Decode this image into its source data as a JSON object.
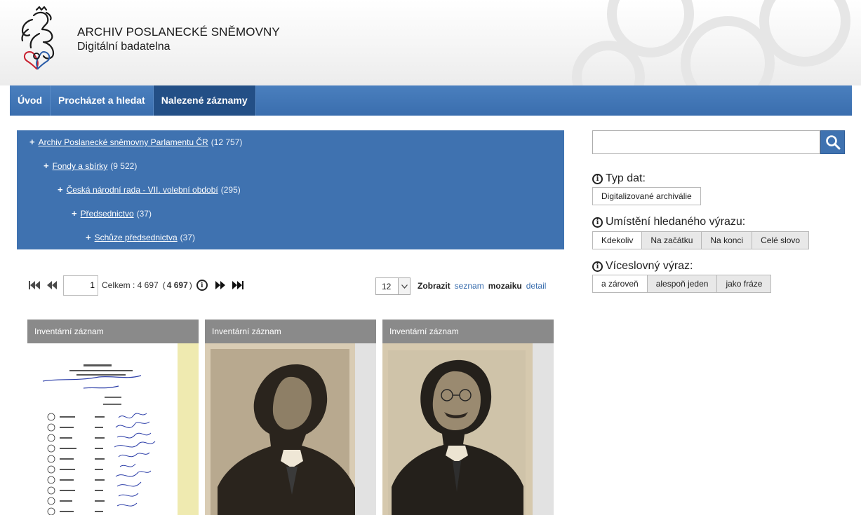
{
  "header": {
    "title": "ARCHIV POSLANECKÉ SNĚMOVNY",
    "subtitle": "Digitální badatelna"
  },
  "nav": {
    "items": [
      {
        "label": "Úvod"
      },
      {
        "label": "Procházet a hledat"
      },
      {
        "label": "Nalezené záznamy",
        "active": true
      }
    ]
  },
  "tree": {
    "items": [
      {
        "label": "Archiv Poslanecké sněmovny Parlamentu ČR",
        "count": "(12 757)"
      },
      {
        "label": "Fondy a sbírky",
        "count": "(9 522)"
      },
      {
        "label": "Česká národní rada - VII. volební období",
        "count": "(295)"
      },
      {
        "label": "Předsednictvo",
        "count": "(37)"
      },
      {
        "label": "Schůze předsednictva",
        "count": "(37)"
      }
    ]
  },
  "pager": {
    "page": "1",
    "total_label": "Celkem : 4 697",
    "total_bold": "4 697",
    "per_page": "12"
  },
  "view": {
    "label": "Zobrazit",
    "list": "seznam",
    "mosaic": "mozaiku",
    "detail": "detail"
  },
  "cards": [
    {
      "title": "Inventární záznam"
    },
    {
      "title": "Inventární záznam"
    },
    {
      "title": "Inventární záznam"
    }
  ],
  "search": {
    "placeholder": "",
    "value": ""
  },
  "facets": {
    "data_type": {
      "title": "Typ dat:",
      "options": [
        "Digitalizované archiválie"
      ]
    },
    "position": {
      "title": "Umístění hledaného výrazu:",
      "options": [
        "Kdekoliv",
        "Na začátku",
        "Na konci",
        "Celé slovo"
      ],
      "selected": "Kdekoliv"
    },
    "multiword": {
      "title": "Víceslovný výraz:",
      "options": [
        "a zároveň",
        "alespoň jeden",
        "jako fráze"
      ],
      "selected": "a zároveň"
    }
  },
  "colors": {
    "nav": "#3a6eae",
    "nav_active": "#234f86",
    "tree": "#3f72b0",
    "card_head": "#8a8a8a"
  }
}
